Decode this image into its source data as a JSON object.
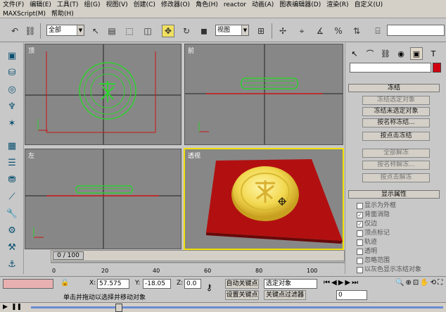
{
  "menu": {
    "row1": [
      "文件(F)",
      "编辑(E)",
      "工具(T)",
      "组(G)",
      "视图(V)",
      "创建(C)",
      "修改器(O)",
      "角色(H)",
      "reactor",
      "动画(A)",
      "图表编辑器(D)",
      "渲染(R)",
      "自定义(U)"
    ],
    "row2": [
      "MAXScript(M)",
      "帮助(H)"
    ]
  },
  "toolbar": {
    "selection_filter": "全部",
    "reference_coord": "视图"
  },
  "viewports": {
    "top": "顶",
    "front": "前",
    "left": "左",
    "perspective": "透视"
  },
  "command_panel": {
    "rollout_freeze": "冻结",
    "buttons": [
      "冻结选定对象",
      "冻结未选定对象",
      "按名称冻结...",
      "按点击冻结",
      "全部解冻",
      "按名称解冻...",
      "按点击解冻"
    ],
    "rollout_display_props": "显示属性",
    "checks": [
      {
        "label": "显示为外框",
        "checked": false
      },
      {
        "label": "背面消隐",
        "checked": true
      },
      {
        "label": "仅边",
        "checked": true
      },
      {
        "label": "顶点标记",
        "checked": false
      },
      {
        "label": "轨迹",
        "checked": false
      },
      {
        "label": "透明",
        "checked": false
      },
      {
        "label": "忽略范围",
        "checked": false
      },
      {
        "label": "以灰色显示冻结对象",
        "checked": false
      }
    ]
  },
  "timeline": {
    "frame_display": "0 / 100",
    "ticks": [
      "0",
      "20",
      "40",
      "60",
      "80",
      "100"
    ]
  },
  "status": {
    "coord_x_label": "X:",
    "coord_x": "57.575",
    "coord_y_label": "Y:",
    "coord_y": "-18.05",
    "coord_z_label": "Z:",
    "coord_z": "0.0",
    "auto_key": "自动关键点",
    "selected_objects": "选定对象",
    "set_key": "设置关键点",
    "key_filter": "关键点过滤器",
    "frame_num": "0",
    "hint": "单击并拖动以选择并移动对象"
  },
  "colors": {
    "viewport_bg": "#878787",
    "green_wire": "#2fd22f",
    "red_grid": "#c81414",
    "active_border": "#f0e000"
  }
}
